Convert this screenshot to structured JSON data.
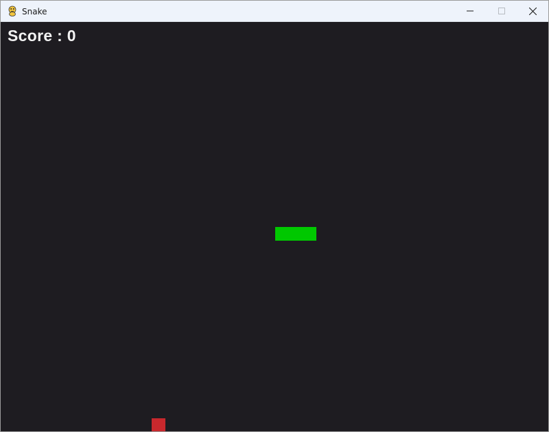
{
  "window": {
    "title": "Snake",
    "icon": "pygame-snake-icon",
    "controls": {
      "minimize_icon": "minimize-icon",
      "maximize_icon": "maximize-icon",
      "close_icon": "close-icon"
    }
  },
  "game": {
    "score_label": "Score : 0",
    "colors": {
      "background": "#1e1c21",
      "snake": "#00c800",
      "food": "#c8282d",
      "score_text": "#f2f2f2"
    },
    "snake_segments": 3
  }
}
